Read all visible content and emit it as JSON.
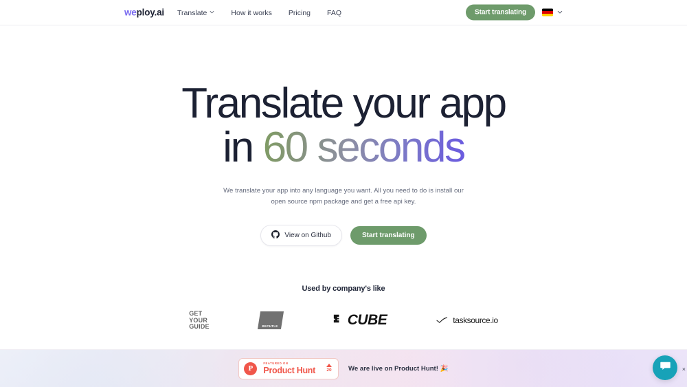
{
  "header": {
    "logo": {
      "accent": "we",
      "rest": "ploy.ai"
    },
    "nav": [
      {
        "label": "Translate",
        "has_caret": true
      },
      {
        "label": "How it works",
        "has_caret": false
      },
      {
        "label": "Pricing",
        "has_caret": false
      },
      {
        "label": "FAQ",
        "has_caret": false
      }
    ],
    "cta_label": "Start translating",
    "language": {
      "flag": "de-flag-icon",
      "caret": "chevron-down-icon"
    }
  },
  "hero": {
    "heading_line1": "Translate your app",
    "heading_line2_prefix": "in ",
    "heading_line2_gradient": "60 seconds",
    "subtitle": "We translate your app into any language you want. All you need to do is install our open source npm package and get a free api key.",
    "github_button": "View on Github",
    "primary_button": "Start translating"
  },
  "social_proof": {
    "title": "Used by company's like",
    "logos": [
      {
        "name": "getyourguide",
        "line1": "GET",
        "line2": "YOUR",
        "line3": "GUIDE"
      },
      {
        "name": "bechtle",
        "text": "BECHTLE"
      },
      {
        "name": "cube",
        "text": "CUBE"
      },
      {
        "name": "tasksource",
        "text": "tasksource.io"
      }
    ]
  },
  "banner": {
    "badge": {
      "mark": "P",
      "small_label": "FEATURED ON",
      "large_label": "Product Hunt",
      "upvote_count": "20"
    },
    "message": "We are live on Product Hunt! 🎉"
  },
  "chat": {
    "icon": "chat-bubble-icon",
    "close": "×"
  },
  "colors": {
    "green": "#6e9b6b",
    "purple": "#7b6cf0",
    "product_hunt_red": "#f0564a",
    "chat_teal": "#17a2b8",
    "heading": "#1c2133"
  }
}
